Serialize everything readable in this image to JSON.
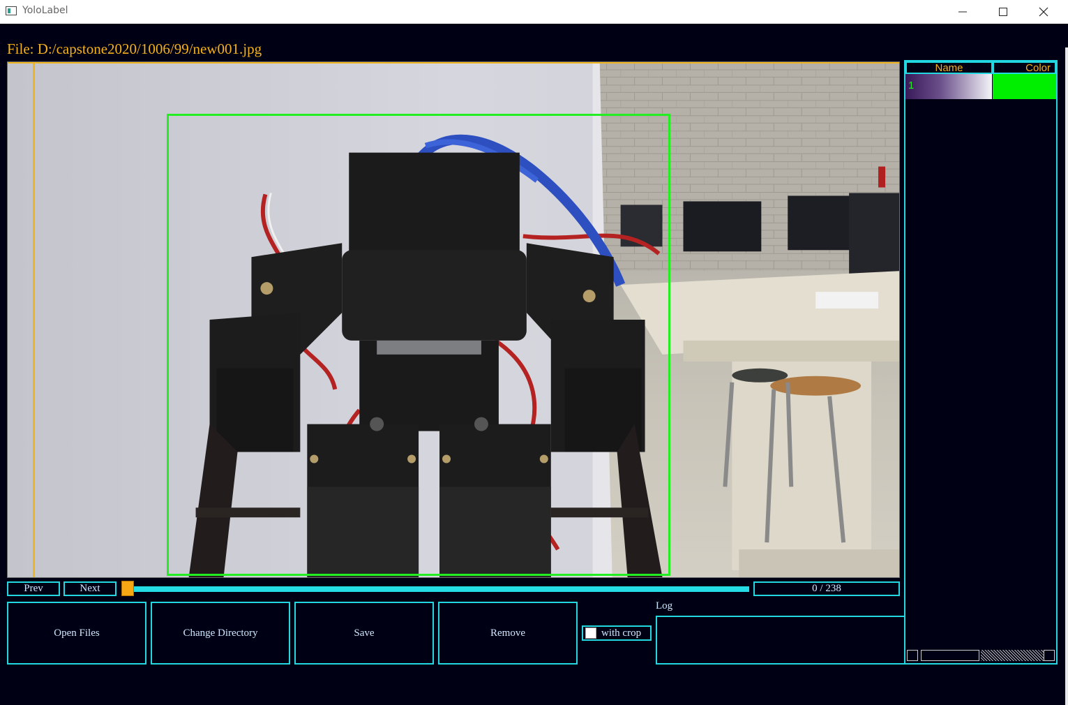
{
  "window": {
    "title": "YoloLabel",
    "minimize_icon": "minimize-icon",
    "maximize_icon": "maximize-icon",
    "close_icon": "close-icon"
  },
  "file": {
    "label": "File: D:/capstone2020/1006/99/new001.jpg"
  },
  "annotation": {
    "class_id": "1",
    "box_color": "#22ee22",
    "guide_color": "#f0b41c"
  },
  "nav": {
    "prev": "Prev",
    "next": "Next",
    "counter": "0 / 238",
    "slider_progress": 0
  },
  "buttons": {
    "open_files": "Open Files",
    "change_directory": "Change Directory",
    "save": "Save",
    "remove": "Remove"
  },
  "crop": {
    "label": "with crop",
    "checked": false
  },
  "log": {
    "label": "Log",
    "content": ""
  },
  "class_table": {
    "headers": {
      "name": "Name",
      "color": "Color"
    },
    "rows": [
      {
        "name": "1",
        "color": "#00ee00"
      }
    ]
  },
  "colors": {
    "accent": "#23d8e0",
    "label_text": "#f5b21a",
    "background": "#000014"
  }
}
